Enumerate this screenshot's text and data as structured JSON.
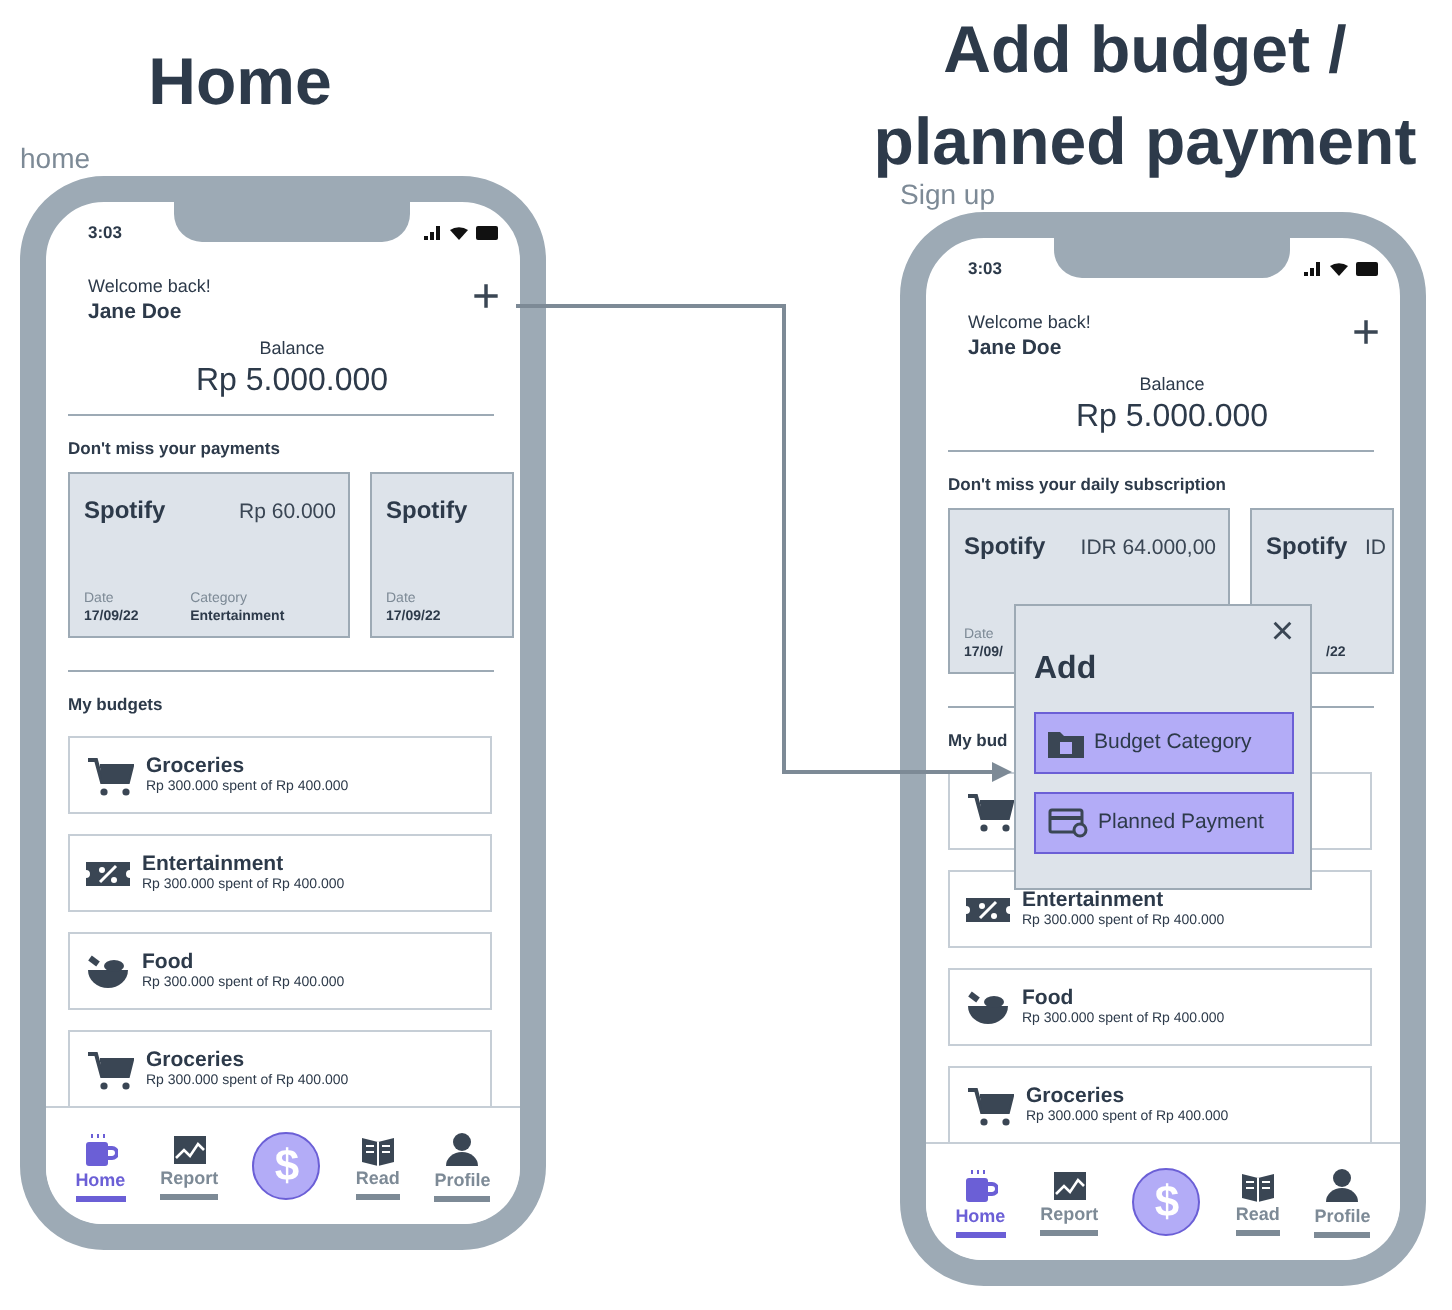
{
  "titles": [
    {
      "text": "Home",
      "kind": "left"
    },
    {
      "text": "Add budget / planned payment",
      "kind": "right"
    }
  ],
  "tags": [
    {
      "text": "home",
      "kind": "left"
    },
    {
      "text": "Sign up",
      "kind": "right"
    }
  ],
  "phones": [
    {
      "time": "3:03",
      "greeting": "Welcome back!",
      "user": "Jane Doe",
      "add": "+",
      "balance_label": "Balance",
      "balance": "Rp 5.000.000",
      "payments_heading": "Don't miss your payments",
      "payments": [
        {
          "name": "Spotify",
          "amount": "Rp 60.000",
          "date_label": "Date",
          "date": "17/09/22",
          "category_label": "Category",
          "category": "Entertainment"
        },
        {
          "name": "Spotify",
          "date_label": "Date",
          "date": "17/09/22"
        }
      ],
      "budgets_heading": "My budgets",
      "budgets": [
        {
          "kind": "cart",
          "name": "Groceries",
          "detail": "Rp 300.000 spent of Rp 400.000"
        },
        {
          "kind": "ticket",
          "name": "Entertainment",
          "detail": "Rp 300.000 spent of Rp 400.000"
        },
        {
          "kind": "bowl",
          "name": "Food",
          "detail": "Rp 300.000 spent of Rp 400.000"
        },
        {
          "kind": "cart",
          "name": "Groceries",
          "detail": "Rp 300.000 spent of Rp 400.000"
        }
      ],
      "nav": [
        {
          "kind": "tab",
          "label": "Home",
          "selected": true
        },
        {
          "kind": "tab",
          "label": "Report",
          "selected": false
        },
        {
          "kind": "action",
          "label": "$"
        },
        {
          "kind": "tab",
          "label": "Read",
          "selected": false
        },
        {
          "kind": "tab",
          "label": "Profile",
          "selected": false
        }
      ]
    },
    {
      "time": "3:03",
      "greeting": "Welcome back!",
      "user": "Jane Doe",
      "add": "+",
      "balance_label": "Balance",
      "balance": "Rp 5.000.000",
      "payments_heading": "Don't miss your daily subscription",
      "payments": [
        {
          "name": "Spotify",
          "amount": "IDR 64.000,00",
          "date_label": "Date",
          "date": "17/09/"
        },
        {
          "name": "Spotify",
          "amount": "ID",
          "date": "/22"
        }
      ],
      "budgets_heading": "My bud",
      "budgets": [
        {
          "kind": "cart"
        },
        {
          "kind": "ticket",
          "name": "Entertainment",
          "detail": "Rp 300.000 spent of Rp 400.000"
        },
        {
          "kind": "bowl",
          "name": "Food",
          "detail": "Rp 300.000 spent of Rp 400.000"
        },
        {
          "kind": "cart",
          "name": "Groceries",
          "detail": "Rp 300.000 spent of Rp 400.000"
        }
      ],
      "nav": [
        {
          "kind": "tab",
          "label": "Home",
          "selected": true
        },
        {
          "kind": "tab",
          "label": "Report",
          "selected": false
        },
        {
          "kind": "action",
          "label": "$"
        },
        {
          "kind": "tab",
          "label": "Read",
          "selected": false
        },
        {
          "kind": "tab",
          "label": "Profile",
          "selected": false
        }
      ],
      "popup": {
        "title": "Add",
        "close": "×",
        "options": [
          {
            "kind": "category",
            "label": "Budget Category"
          },
          {
            "kind": "payment",
            "label": "Planned Payment"
          }
        ]
      }
    }
  ]
}
